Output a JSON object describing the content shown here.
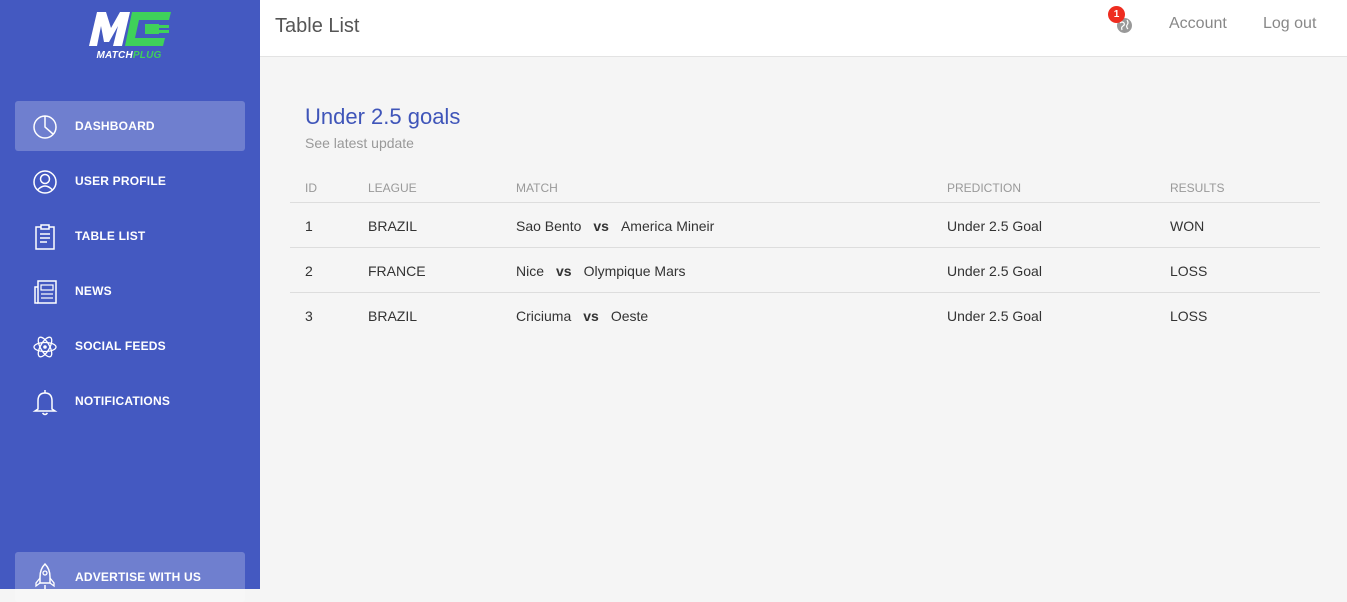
{
  "brand": {
    "logo_word_1": "MATCH",
    "logo_word_2": "PLUG"
  },
  "sidebar": {
    "items": [
      {
        "label": "DASHBOARD",
        "icon": "pie-chart-icon",
        "active": true
      },
      {
        "label": "USER PROFILE",
        "icon": "user-icon",
        "active": false
      },
      {
        "label": "TABLE LIST",
        "icon": "clipboard-icon",
        "active": false
      },
      {
        "label": "NEWS",
        "icon": "news-icon",
        "active": false
      },
      {
        "label": "SOCIAL FEEDS",
        "icon": "atom-icon",
        "active": false
      },
      {
        "label": "NOTIFICATIONS",
        "icon": "bell-icon",
        "active": false
      }
    ],
    "advertise": {
      "label": "ADVERTISE WITH US",
      "icon": "rocket-icon"
    }
  },
  "header": {
    "title": "Table List",
    "notification_count": "1",
    "account_label": "Account",
    "logout_label": "Log out"
  },
  "card": {
    "title": "Under 2.5 goals",
    "subtitle": "See latest update"
  },
  "table": {
    "columns": [
      "ID",
      "LEAGUE",
      "MATCH",
      "PREDICTION",
      "RESULTS"
    ],
    "vs_label": "vs",
    "rows": [
      {
        "id": "1",
        "league": "BRAZIL",
        "home": "Sao Bento",
        "away": "America Mineir",
        "prediction": "Under 2.5 Goal",
        "result": "WON"
      },
      {
        "id": "2",
        "league": "FRANCE",
        "home": "Nice",
        "away": "Olympique Mars",
        "prediction": "Under 2.5 Goal",
        "result": "LOSS"
      },
      {
        "id": "3",
        "league": "BRAZIL",
        "home": "Criciuma",
        "away": "Oeste",
        "prediction": "Under 2.5 Goal",
        "result": "LOSS"
      }
    ]
  },
  "colors": {
    "sidebar": "#4459c1",
    "accent_title": "#3f55b9",
    "logo_green": "#3fd15a",
    "badge": "#ee2d20"
  }
}
